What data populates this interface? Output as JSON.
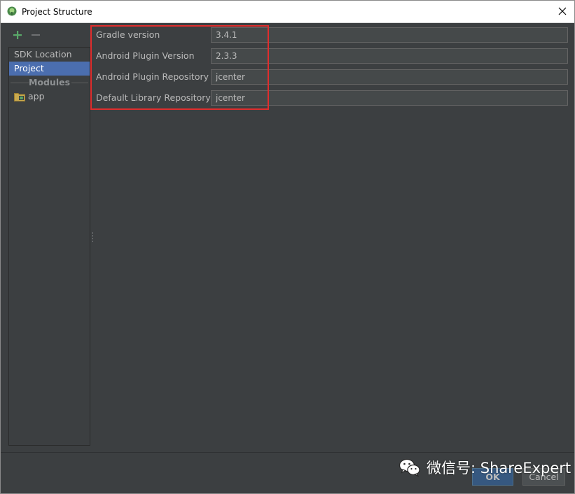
{
  "window": {
    "title": "Project Structure"
  },
  "sidebar": {
    "items": [
      {
        "label": "SDK Location",
        "selected": false
      },
      {
        "label": "Project",
        "selected": true
      }
    ],
    "group_label": "Modules",
    "modules": [
      {
        "label": "app",
        "icon": "module-folder-icon"
      }
    ]
  },
  "form": {
    "fields": [
      {
        "label": "Gradle version",
        "value": "3.4.1"
      },
      {
        "label": "Android Plugin Version",
        "value": "2.3.3"
      },
      {
        "label": "Android Plugin Repository",
        "value": "jcenter"
      },
      {
        "label": "Default Library Repository",
        "value": "jcenter"
      }
    ]
  },
  "buttons": {
    "ok": "OK",
    "cancel": "Cancel"
  },
  "watermark": {
    "text": "微信号: ShareExpert"
  },
  "colors": {
    "background": "#3c3f41",
    "selection": "#4b6eaf",
    "highlight_box": "#e02d2d",
    "add_icon": "#59a869"
  }
}
